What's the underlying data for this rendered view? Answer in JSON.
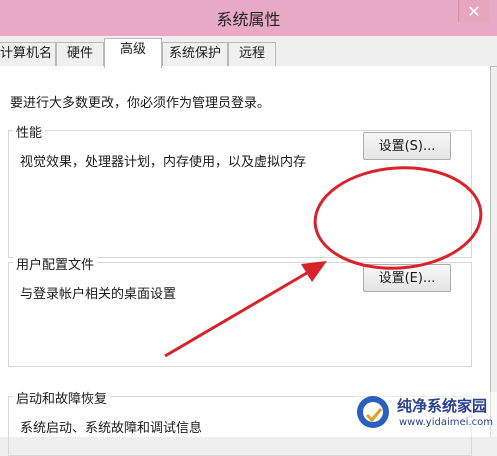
{
  "window": {
    "title": "系统属性",
    "close_label": "✕"
  },
  "tabs": [
    {
      "label": "计算机名"
    },
    {
      "label": "硬件"
    },
    {
      "label": "高级",
      "selected": true
    },
    {
      "label": "系统保护"
    },
    {
      "label": "远程"
    }
  ],
  "advanced": {
    "intro": "要进行大多数更改，你必须作为管理员登录。",
    "performance": {
      "title": "性能",
      "description": "视觉效果，处理器计划，内存使用，以及虚拟内存",
      "button": "设置(S)..."
    },
    "user_profiles": {
      "title": "用户配置文件",
      "description": "与登录帐户相关的桌面设置",
      "button": "设置(E)..."
    },
    "startup_recovery": {
      "title": "启动和故障恢复",
      "description": "系统启动、系统故障和调试信息"
    }
  },
  "annotation": {
    "color": "#d9232a",
    "icons": [
      "red-ellipse-highlight",
      "red-arrow"
    ]
  },
  "watermark": {
    "name": "纯净系统家园",
    "url": "www.yidaimei.com"
  },
  "colors": {
    "titlebar": "#e7a9c6",
    "window_bg": "#f0eff0",
    "panel_bg": "#ffffff"
  }
}
